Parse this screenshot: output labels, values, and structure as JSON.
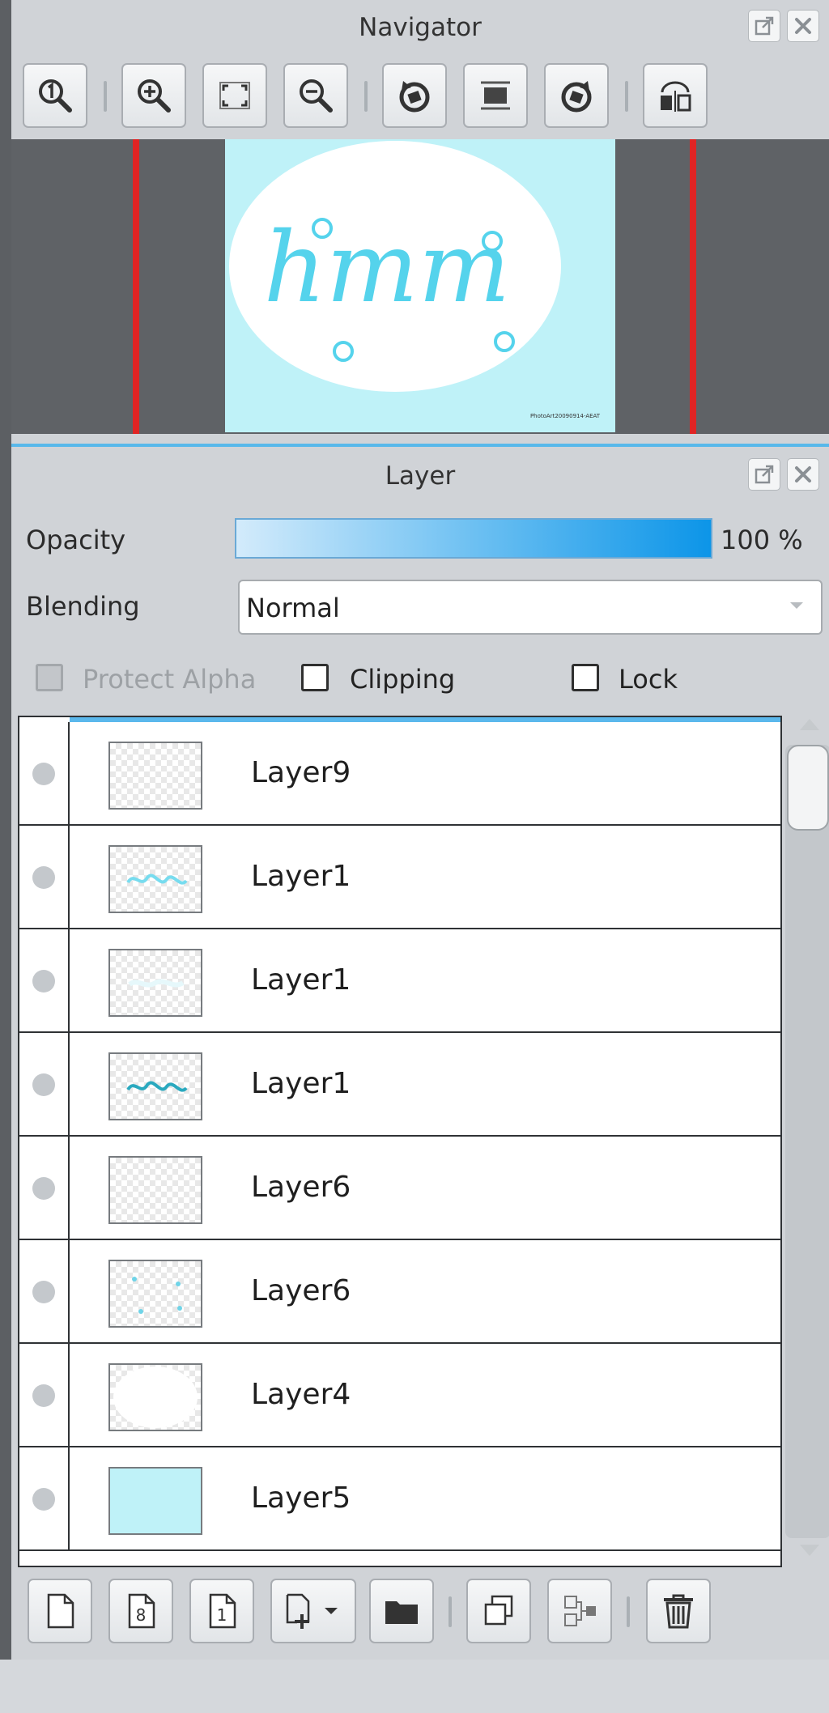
{
  "navigator": {
    "title": "Navigator",
    "toolbar": [
      {
        "icon": "zoom-actual-size-icon"
      },
      {
        "icon": "zoom-in-icon"
      },
      {
        "icon": "fit-to-window-icon"
      },
      {
        "icon": "zoom-out-icon"
      },
      {
        "icon": "rotate-left-icon"
      },
      {
        "icon": "reset-view-icon"
      },
      {
        "icon": "rotate-right-icon"
      },
      {
        "icon": "flip-horizontal-icon"
      }
    ],
    "preview": {
      "canvas_color": "#bff2f8",
      "artwork_text": "hmm",
      "watermark_text": "PhotoArt20090914-AEAT"
    }
  },
  "layer_panel": {
    "title": "Layer",
    "opacity": {
      "label": "Opacity",
      "value": 100,
      "display": "100 %"
    },
    "blending": {
      "label": "Blending",
      "value": "Normal"
    },
    "checks": [
      {
        "label": "Protect Alpha",
        "checked": false,
        "disabled": true
      },
      {
        "label": "Clipping",
        "checked": false,
        "disabled": false
      },
      {
        "label": "Lock",
        "checked": false,
        "disabled": false
      }
    ],
    "layers": [
      {
        "name": "Layer9",
        "thumb": "empty"
      },
      {
        "name": "Layer1",
        "thumb": "text-light"
      },
      {
        "name": "Layer1",
        "thumb": "faint"
      },
      {
        "name": "Layer1",
        "thumb": "text-dark"
      },
      {
        "name": "Layer6",
        "thumb": "empty"
      },
      {
        "name": "Layer6",
        "thumb": "dots"
      },
      {
        "name": "Layer4",
        "thumb": "white-oval"
      },
      {
        "name": "Layer5",
        "thumb": "solid"
      }
    ],
    "bottom_toolbar": [
      {
        "icon": "new-layer-icon"
      },
      {
        "icon": "new-8bit-layer-icon"
      },
      {
        "icon": "new-1bit-layer-icon"
      },
      {
        "icon": "add-layer-dropdown-icon"
      },
      {
        "icon": "new-folder-icon"
      },
      {
        "icon": "duplicate-layer-icon"
      },
      {
        "icon": "merge-down-icon"
      },
      {
        "icon": "delete-layer-icon"
      }
    ]
  },
  "colors": {
    "accent": "#0c95e8",
    "panel_bg": "#d0d3d7",
    "nav_bg": "#5f6266",
    "guide_red": "#e02424"
  }
}
